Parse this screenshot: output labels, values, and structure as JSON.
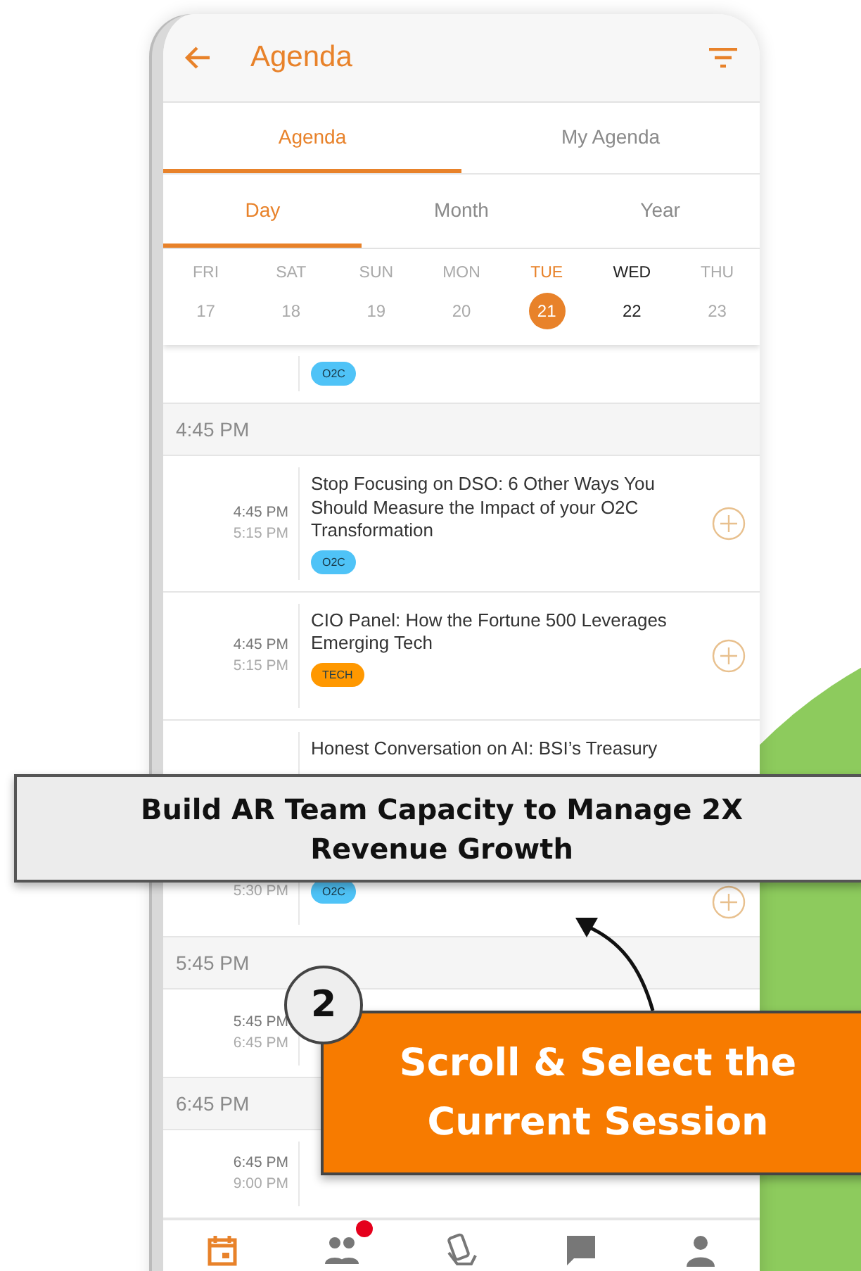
{
  "header": {
    "title": "Agenda"
  },
  "tabs": [
    {
      "label": "Agenda",
      "selected": true
    },
    {
      "label": "My Agenda",
      "selected": false
    }
  ],
  "view_tabs": [
    {
      "label": "Day",
      "selected": true
    },
    {
      "label": "Month",
      "selected": false
    },
    {
      "label": "Year",
      "selected": false
    }
  ],
  "week": [
    {
      "weekday": "FRI",
      "date": "17",
      "selected": false,
      "kind": "muted"
    },
    {
      "weekday": "SAT",
      "date": "18",
      "selected": false,
      "kind": "muted"
    },
    {
      "weekday": "SUN",
      "date": "19",
      "selected": false,
      "kind": "muted"
    },
    {
      "weekday": "MON",
      "date": "20",
      "selected": false,
      "kind": "muted"
    },
    {
      "weekday": "TUE",
      "date": "21",
      "selected": true,
      "kind": "muted"
    },
    {
      "weekday": "WED",
      "date": "22",
      "selected": false,
      "kind": "active"
    },
    {
      "weekday": "THU",
      "date": "23",
      "selected": false,
      "kind": "muted"
    }
  ],
  "schedule": [
    {
      "kind": "session",
      "tag": {
        "label": "O2C",
        "color": "#4fc3f7"
      },
      "add_button": false
    },
    {
      "kind": "section",
      "label": "4:45 PM"
    },
    {
      "kind": "session",
      "start": "4:45 PM",
      "end": "5:15 PM",
      "title": "Stop Focusing on DSO: 6 Other Ways You Should Measure the Impact of your O2C Transformation",
      "tag": {
        "label": "O2C",
        "color": "#4fc3f7"
      },
      "add_button": true
    },
    {
      "kind": "session",
      "start": "4:45 PM",
      "end": "5:15 PM",
      "title": "CIO Panel: How the Fortune 500 Leverages Emerging Tech",
      "tag": {
        "label": "TECH",
        "color": "#ff9800"
      },
      "add_button": true
    },
    {
      "kind": "session",
      "title": "Honest Conversation on AI: BSI’s Treasury",
      "add_button": false
    },
    {
      "kind": "session",
      "end": "5:30 PM",
      "tag": {
        "label": "O2C",
        "color": "#4fc3f7"
      },
      "add_button": true
    },
    {
      "kind": "section",
      "label": "5:45 PM"
    },
    {
      "kind": "session",
      "start": "5:45 PM",
      "end": "6:45 PM",
      "add_button": false
    },
    {
      "kind": "section",
      "label": "6:45 PM"
    },
    {
      "kind": "session",
      "start": "6:45 PM",
      "end": "9:00 PM",
      "add_button": false
    }
  ],
  "bottom_nav": [
    {
      "kind": "calendar",
      "selected": true,
      "badge": false
    },
    {
      "kind": "people",
      "selected": false,
      "badge": true
    },
    {
      "kind": "hand",
      "selected": false,
      "badge": false
    },
    {
      "kind": "chat",
      "selected": false,
      "badge": false
    },
    {
      "kind": "person",
      "selected": false,
      "badge": false
    }
  ],
  "callouts": [
    {
      "kind": "banner",
      "text": "Build AR Team Capacity to Manage 2X Revenue Growth"
    },
    {
      "kind": "step",
      "number": "2",
      "text": "Scroll & Select the Current Session"
    }
  ]
}
